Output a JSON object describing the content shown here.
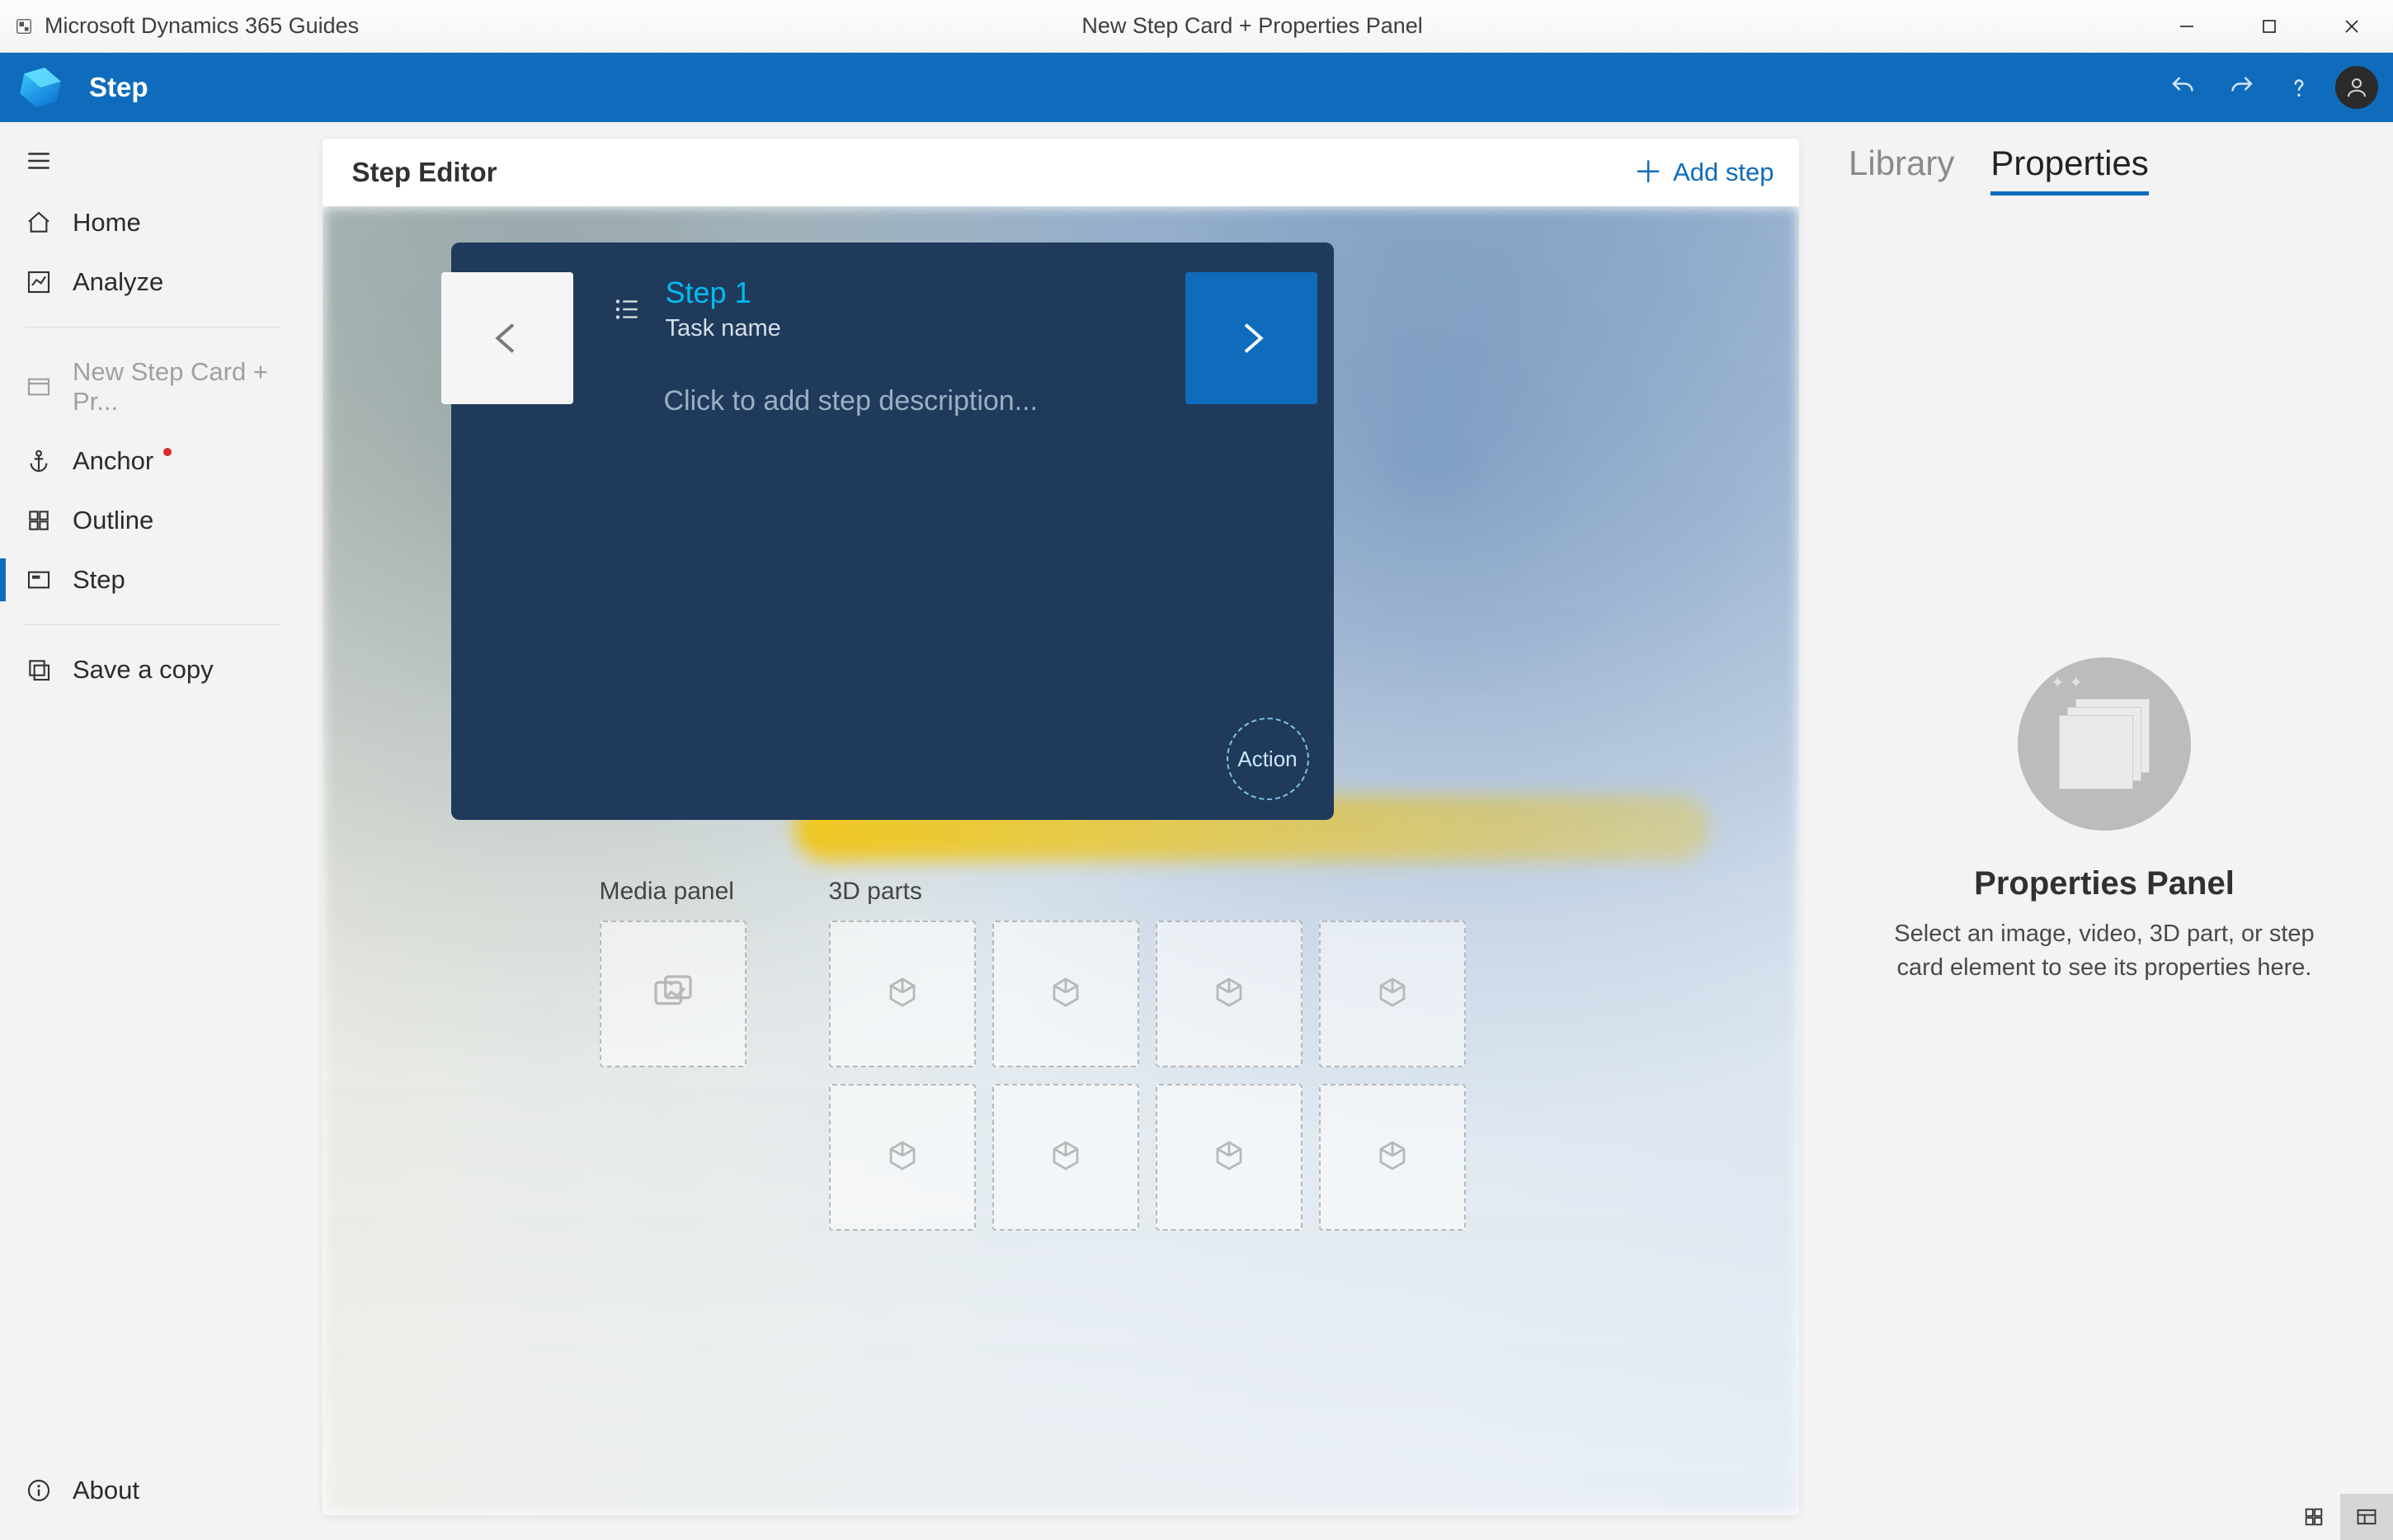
{
  "titlebar": {
    "app_name": "Microsoft Dynamics 365 Guides",
    "document_title": "New Step Card + Properties Panel"
  },
  "ribbon": {
    "title": "Step"
  },
  "sidebar": {
    "home": "Home",
    "analyze": "Analyze",
    "recent_guide": "New Step Card + Pr...",
    "anchor": "Anchor",
    "outline": "Outline",
    "step": "Step",
    "save_copy": "Save a copy",
    "about": "About"
  },
  "editor": {
    "title": "Step Editor",
    "add_step": "Add step",
    "media_panel_label": "Media panel",
    "parts_label": "3D parts"
  },
  "step_card": {
    "title": "Step 1",
    "task": "Task name",
    "description_placeholder": "Click to add step description...",
    "action_label": "Action"
  },
  "right_panel": {
    "tabs": {
      "library": "Library",
      "properties": "Properties"
    },
    "placeholder_title": "Properties Panel",
    "placeholder_body": "Select an image, video, 3D part, or step card element to see its properties here."
  }
}
